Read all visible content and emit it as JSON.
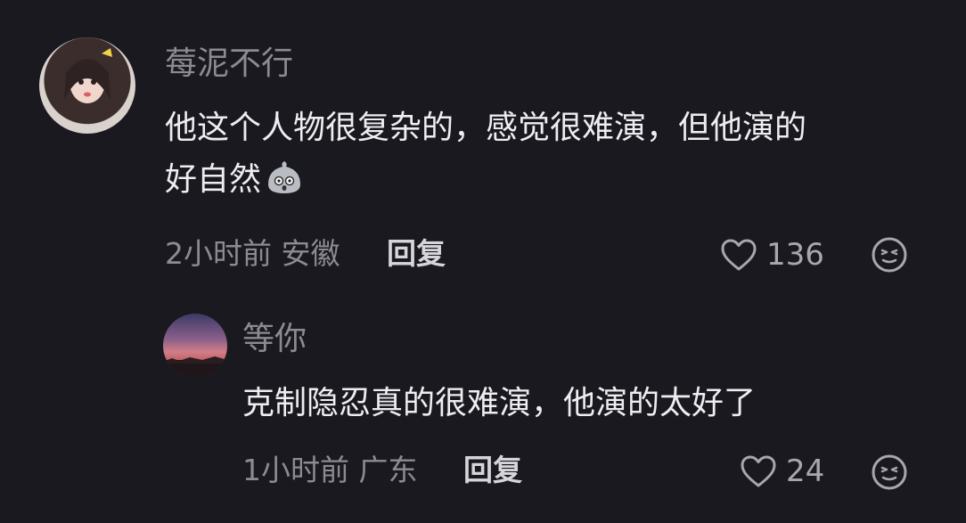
{
  "comments": [
    {
      "username": "莓泥不行",
      "text_line1": "他这个人物很复杂的，感觉很难演，但他演的",
      "text_line2": "好自然",
      "emoji": "shocked-face-emoji",
      "time_location": "2小时前 安徽",
      "reply_label": "回复",
      "likes": "136"
    },
    {
      "username": "等你",
      "text_line1": "克制隐忍真的很难演，他演的太好了",
      "time_location": "1小时前 广东",
      "reply_label": "回复",
      "likes": "24"
    }
  ],
  "icons": {
    "like": "heart-outline-icon",
    "react": "smile-face-icon"
  },
  "colors": {
    "background": "#1a1920",
    "text_primary": "#eeeef0",
    "text_secondary": "#8c8b92"
  }
}
